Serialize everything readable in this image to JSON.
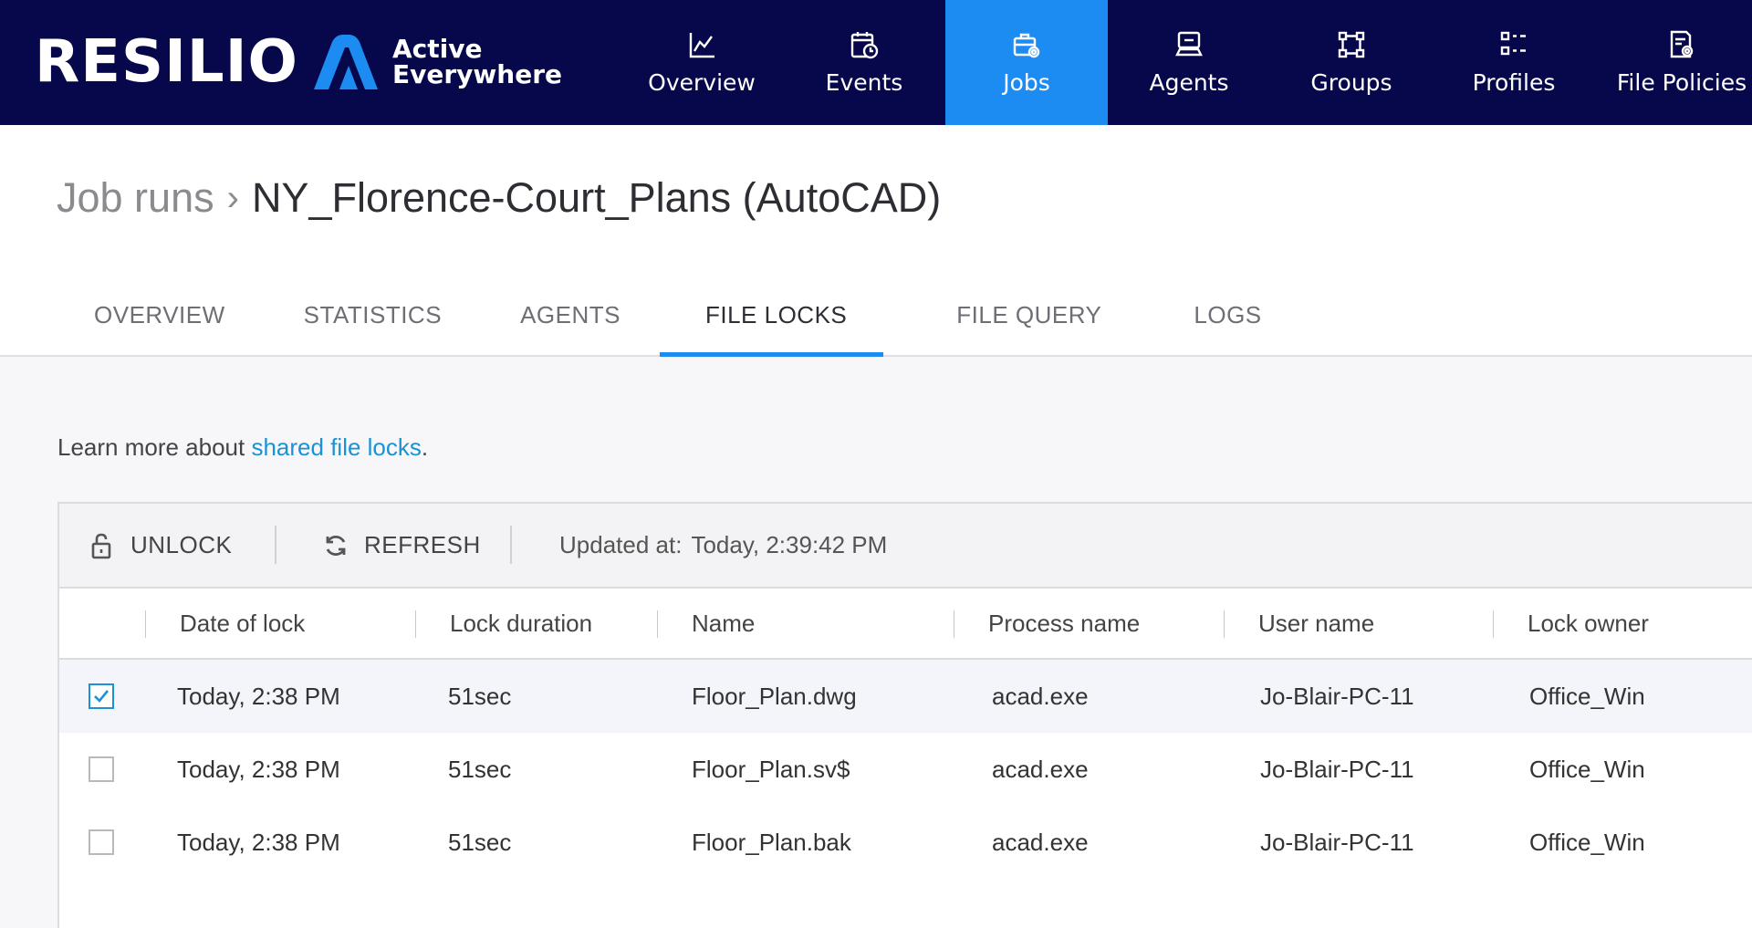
{
  "brand": {
    "name": "RESILIO",
    "product_line1": "Active",
    "product_line2": "Everywhere"
  },
  "nav": {
    "items": [
      {
        "label": "Overview",
        "icon": "chart-line-icon",
        "active": false
      },
      {
        "label": "Events",
        "icon": "calendar-clock-icon",
        "active": false
      },
      {
        "label": "Jobs",
        "icon": "briefcase-gear-icon",
        "active": true
      },
      {
        "label": "Agents",
        "icon": "computer-icon",
        "active": false
      },
      {
        "label": "Groups",
        "icon": "group-nodes-icon",
        "active": false
      },
      {
        "label": "Profiles",
        "icon": "profiles-list-icon",
        "active": false
      },
      {
        "label": "File Policies",
        "icon": "file-policy-gear-icon",
        "active": false
      }
    ]
  },
  "breadcrumb": {
    "parent": "Job runs",
    "separator": "›",
    "current": "NY_Florence-Court_Plans (AutoCAD)"
  },
  "tabs": [
    {
      "label": "OVERVIEW",
      "active": false
    },
    {
      "label": "STATISTICS",
      "active": false
    },
    {
      "label": "AGENTS",
      "active": false
    },
    {
      "label": "FILE LOCKS",
      "active": true
    },
    {
      "label": "FILE QUERY",
      "active": false
    },
    {
      "label": "LOGS",
      "active": false
    }
  ],
  "learn_more": {
    "prefix": "Learn more about ",
    "link": "shared file locks",
    "suffix": "."
  },
  "toolbar": {
    "unlock_label": "UNLOCK",
    "refresh_label": "REFRESH",
    "updated_label": "Updated at:",
    "updated_value": "Today, 2:39:42 PM"
  },
  "table": {
    "columns": [
      "Date of lock",
      "Lock duration",
      "Name",
      "Process name",
      "User name",
      "Lock owner"
    ],
    "rows": [
      {
        "checked": true,
        "date": "Today, 2:38 PM",
        "duration": "51sec",
        "name": "Floor_Plan.dwg",
        "process": "acad.exe",
        "user": "Jo-Blair-PC-11",
        "owner": "Office_Win"
      },
      {
        "checked": false,
        "date": "Today, 2:38 PM",
        "duration": "51sec",
        "name": "Floor_Plan.sv$",
        "process": "acad.exe",
        "user": "Jo-Blair-PC-11",
        "owner": "Office_Win"
      },
      {
        "checked": false,
        "date": "Today, 2:38 PM",
        "duration": "51sec",
        "name": "Floor_Plan.bak",
        "process": "acad.exe",
        "user": "Jo-Blair-PC-11",
        "owner": "Office_Win"
      }
    ]
  },
  "colors": {
    "nav_bg": "#06084b",
    "accent": "#1d8cf2",
    "link": "#1a92d4"
  }
}
